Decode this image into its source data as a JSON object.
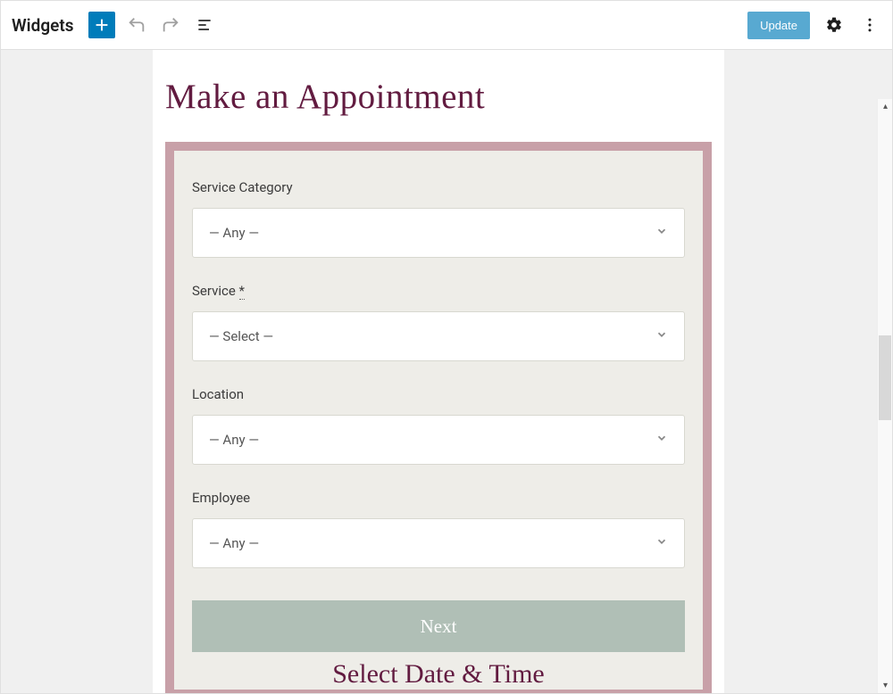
{
  "toolbar": {
    "title": "Widgets",
    "update_label": "Update"
  },
  "form": {
    "heading": "Make an Appointment",
    "fields": {
      "service_category": {
        "label": "Service Category",
        "value": "— Any —"
      },
      "service": {
        "label": "Service ",
        "required_mark": "*",
        "value": "— Select —"
      },
      "location": {
        "label": "Location",
        "value": "— Any —"
      },
      "employee": {
        "label": "Employee",
        "value": "— Any —"
      }
    },
    "next_label": "Next",
    "step2_title": "Select Date & Time"
  }
}
